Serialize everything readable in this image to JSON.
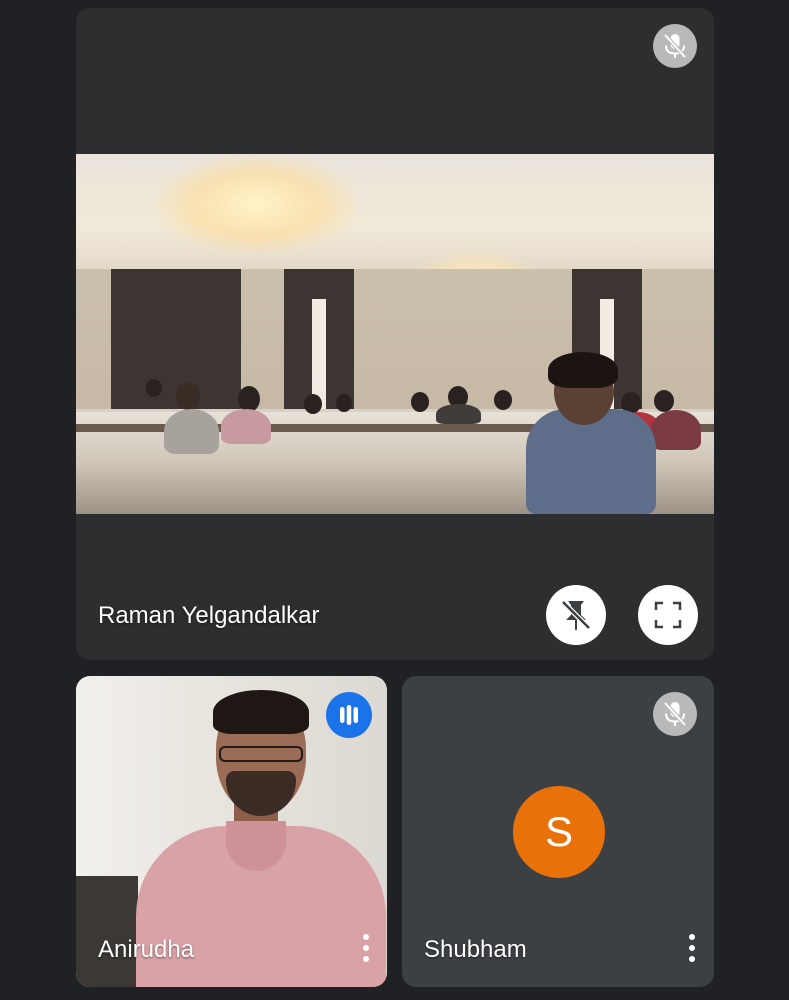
{
  "participants": {
    "main": {
      "name": "Raman Yelgandalkar",
      "mic_state": "muted",
      "icons": [
        "mic-off-icon",
        "unpin-icon",
        "fullscreen-icon"
      ]
    },
    "tile1": {
      "name": "Anirudha",
      "state": "speaking",
      "icons": [
        "speaking-indicator-icon",
        "more-options-icon"
      ]
    },
    "tile2": {
      "name": "Shubham",
      "avatar_letter": "S",
      "mic_state": "muted",
      "icons": [
        "mic-off-icon",
        "more-options-icon"
      ]
    }
  },
  "colors": {
    "background": "#202124",
    "tile": "#3c4043",
    "avatar": "#e8710a",
    "speaking": "#1a73e8",
    "mic_badge": "#b8b9bb"
  }
}
